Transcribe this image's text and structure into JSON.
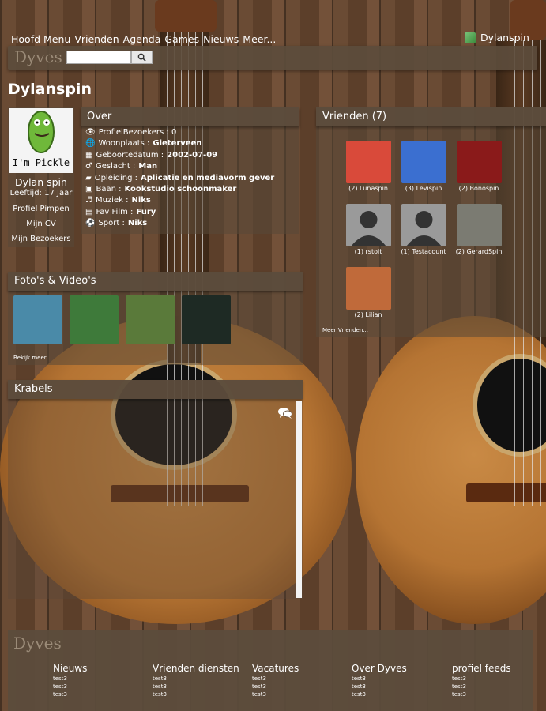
{
  "nav": {
    "items": [
      "Hoofd Menu",
      "Vrienden",
      "Agenda",
      "Games",
      "Nieuws",
      "Meer..."
    ],
    "user": "Dylanspin"
  },
  "brand": {
    "logo": "Dyves",
    "search_placeholder": ""
  },
  "profile": {
    "title": "Dylanspin",
    "avatar_text": "I'm Pickle",
    "name": "Dylan spin",
    "age": "Leeftijd: 17 Jaar",
    "links": [
      "Profiel Pimpen",
      "Mijn CV",
      "Mijn Bezoekers"
    ]
  },
  "about": {
    "title": "Over",
    "rows": [
      {
        "icon": "eye-icon",
        "glyph": "👁",
        "label": "ProfielBezoekers : 0",
        "value": ""
      },
      {
        "icon": "globe-icon",
        "glyph": "🌐",
        "label": "Woonplaats : ",
        "value": "Gieterveen"
      },
      {
        "icon": "calendar-icon",
        "glyph": "▦",
        "label": "Geboortedatum : ",
        "value": "2002-07-09"
      },
      {
        "icon": "male-icon",
        "glyph": "♂",
        "label": "Geslacht : ",
        "value": "Man"
      },
      {
        "icon": "book-icon",
        "glyph": "▰",
        "label": "Opleiding : ",
        "value": "Aplicatie en mediavorm gever"
      },
      {
        "icon": "money-icon",
        "glyph": "▣",
        "label": "Baan : ",
        "value": "Kookstudio schoonmaker"
      },
      {
        "icon": "music-icon",
        "glyph": "♬",
        "label": "Muziek : ",
        "value": "Niks"
      },
      {
        "icon": "film-icon",
        "glyph": "▤",
        "label": "Fav Film : ",
        "value": "Fury"
      },
      {
        "icon": "ball-icon",
        "glyph": "⚽",
        "label": "Sport : ",
        "value": "Niks"
      }
    ]
  },
  "friends": {
    "title": "Vrienden (7)",
    "items": [
      {
        "label": "(2) Lunaspin",
        "color": "#d94a3a"
      },
      {
        "label": "(3) Levispin",
        "color": "#3b6fd0"
      },
      {
        "label": "(2) Bonospin",
        "color": "#8a1a1a"
      },
      {
        "label": "(1) rstoit",
        "color": "#9a9a9a"
      },
      {
        "label": "(1) Testacount",
        "color": "#9a9a9a"
      },
      {
        "label": "(2) GerardSpin",
        "color": "#7b7b72"
      },
      {
        "label": "(2) Lilian",
        "color": "#c06a3a"
      }
    ],
    "more": "Meer Vrienden..."
  },
  "photos": {
    "title": "Foto's & Video's",
    "items": [
      {
        "name": "photo-sea",
        "color": "#4a8aa8"
      },
      {
        "name": "photo-minecraft",
        "color": "#3e7a3a"
      },
      {
        "name": "photo-rugby",
        "color": "#5a7a3a"
      },
      {
        "name": "photo-code",
        "color": "#1e2a24"
      }
    ],
    "more": "Bekijk meer..."
  },
  "krabels": {
    "title": "Krabels"
  },
  "footer": {
    "logo": "Dyves",
    "columns": [
      {
        "title": "Nieuws",
        "items": [
          "test3",
          "test3",
          "test3"
        ]
      },
      {
        "title": "Vrienden diensten",
        "items": [
          "test3",
          "test3",
          "test3"
        ]
      },
      {
        "title": "Vacatures",
        "items": [
          "test3",
          "test3",
          "test3"
        ]
      },
      {
        "title": "Over Dyves",
        "items": [
          "test3",
          "test3",
          "test3"
        ]
      },
      {
        "title": "profiel feeds",
        "items": [
          "test3",
          "test3",
          "test3"
        ]
      }
    ]
  }
}
